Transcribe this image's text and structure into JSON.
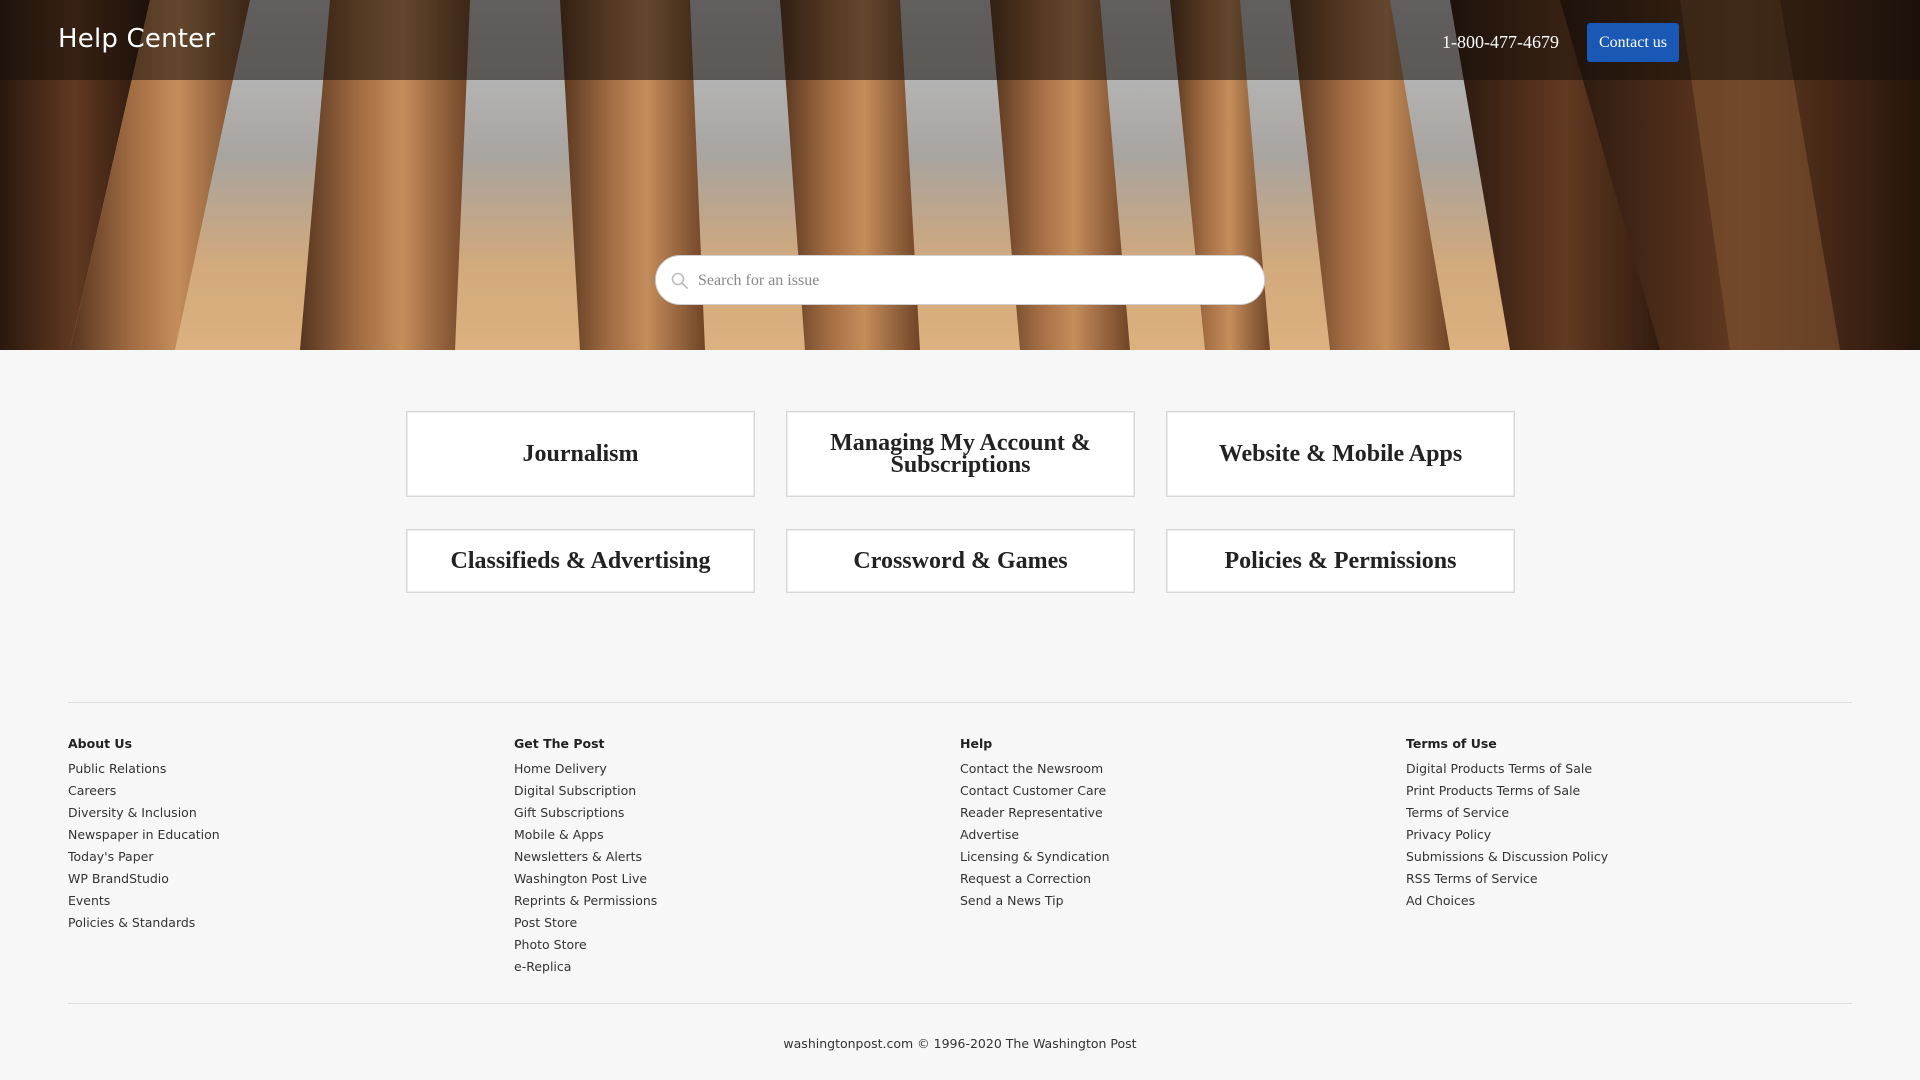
{
  "header": {
    "brand": "Help Center",
    "phone": "1-800-477-4679",
    "contact_label": "Contact us",
    "contact_color": "#1a58b5"
  },
  "search": {
    "placeholder": "Search for an issue",
    "value": "",
    "icon": "search-icon"
  },
  "categories": [
    {
      "label": "Journalism"
    },
    {
      "label": "Managing My Account & Subscriptions"
    },
    {
      "label": "Website & Mobile Apps"
    },
    {
      "label": "Classifieds & Advertising"
    },
    {
      "label": "Crossword & Games"
    },
    {
      "label": "Policies & Permissions"
    }
  ],
  "footer": {
    "columns": [
      {
        "heading": "About Us",
        "links": [
          "Public Relations",
          "Careers",
          "Diversity & Inclusion",
          "Newspaper in Education",
          "Today's Paper",
          "WP BrandStudio",
          "Events",
          "Policies & Standards"
        ]
      },
      {
        "heading": "Get The Post",
        "links": [
          "Home Delivery",
          "Digital Subscription",
          "Gift Subscriptions",
          "Mobile & Apps",
          "Newsletters & Alerts",
          "Washington Post Live",
          "Reprints & Permissions",
          "Post Store",
          "Photo Store",
          "e-Replica"
        ]
      },
      {
        "heading": "Help",
        "links": [
          "Contact the Newsroom",
          "Contact Customer Care",
          "Reader Representative",
          "Advertise",
          "Licensing & Syndication",
          "Request a Correction",
          "Send a News Tip"
        ]
      },
      {
        "heading": "Terms of Use",
        "links": [
          "Digital Products Terms of Sale",
          "Print Products Terms of Sale",
          "Terms of Service",
          "Privacy Policy",
          "Submissions & Discussion Policy",
          "RSS Terms of Service",
          "Ad Choices"
        ]
      }
    ],
    "copyright": "washingtonpost.com © 1996-2020 The Washington Post"
  }
}
